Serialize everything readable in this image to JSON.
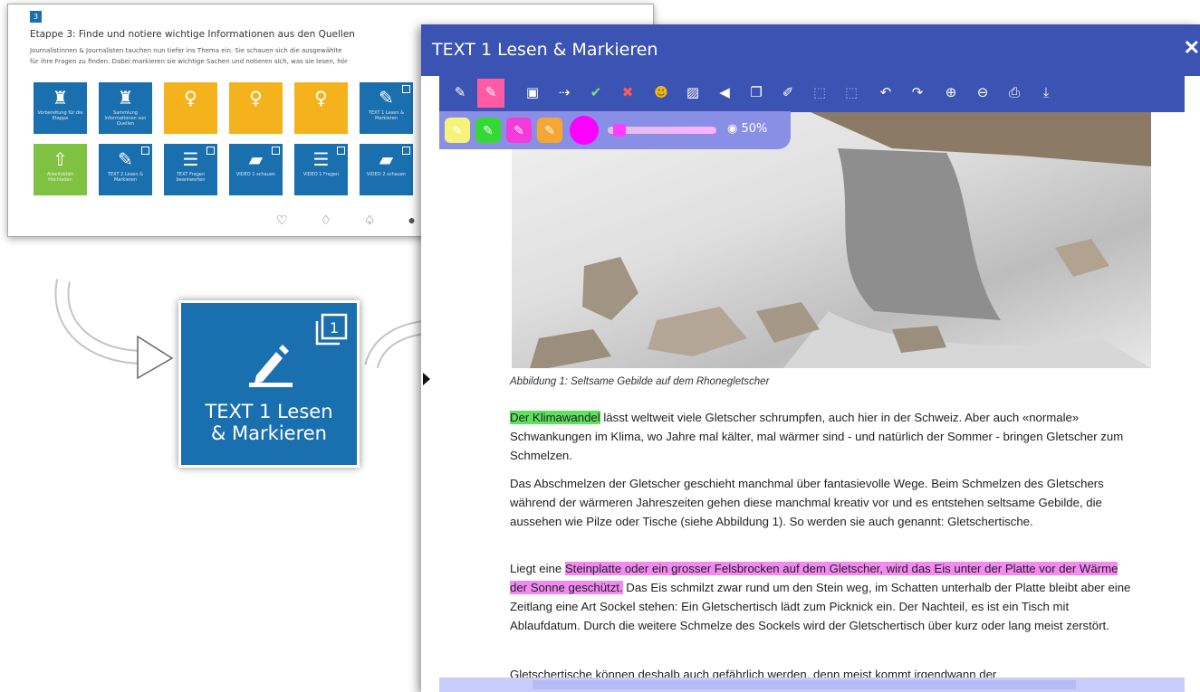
{
  "overview": {
    "step_number": "3",
    "stage_title": "Etappe 3: Finde und notiere wichtige Informationen aus den Quellen",
    "stage_description_line1": "Journalistinnen & Journalisten tauchen nun tiefer ins Thema ein. Sie schauen sich die ausgewählte",
    "stage_description_line2": "für ihre Fragen zu finden. Dabei markieren sie wichtige Sachen und notieren sich, was sie lesen, hör",
    "tiles_row1": [
      {
        "icon": "binoculars-icon",
        "glyph": "♜",
        "color": "blue",
        "label": "Vorbereitung für die Etappe"
      },
      {
        "icon": "binoculars-icon",
        "glyph": "♜",
        "color": "blue",
        "label": "Sammlung Informationen von Quellen"
      },
      {
        "icon": "lightbulb-icon",
        "glyph": "♀",
        "color": "yellow",
        "label": ""
      },
      {
        "icon": "lightbulb-icon",
        "glyph": "♀",
        "color": "yellow",
        "label": ""
      },
      {
        "icon": "lightbulb-icon",
        "glyph": "♀",
        "color": "yellow",
        "label": ""
      },
      {
        "icon": "pencil-icon",
        "glyph": "✎",
        "color": "blue",
        "label": "TEXT 1 Lesen & Markieren"
      }
    ],
    "tiles_row2": [
      {
        "icon": "upload-icon",
        "glyph": "⇧",
        "color": "green",
        "label": "Arbeitsblatt Hochladen"
      },
      {
        "icon": "pencil-icon",
        "glyph": "✎",
        "color": "blue",
        "label": "TEXT 2 Lesen & Markieren"
      },
      {
        "icon": "list-icon",
        "glyph": "☰",
        "color": "blue",
        "label": "TEXT Fragen beantworten"
      },
      {
        "icon": "video-icon",
        "glyph": "▰",
        "color": "blue",
        "label": "VIDEO 1 schauen"
      },
      {
        "icon": "list-icon",
        "glyph": "☰",
        "color": "blue",
        "label": "VIDEO 1 Fragen"
      },
      {
        "icon": "video-icon",
        "glyph": "▰",
        "color": "blue",
        "label": "VIDEO 2 schauen"
      }
    ],
    "feedback_glyphs": "♡ ♢ ♤ ●"
  },
  "zoom_tile": {
    "label_line1": "TEXT 1 Lesen",
    "label_line2": "& Markieren",
    "badge": "1"
  },
  "reader": {
    "title": "TEXT 1 Lesen & Markieren",
    "close_glyph": "✕",
    "opacity_label": "50%",
    "caption": "Abbildung 1: Seltsame Gebilde auf dem Rhonegletscher",
    "p1_hl": "Der Klimawandel",
    "p1_rest": " lässt weltweit viele Gletscher schrumpfen, auch hier in der Schweiz. Aber auch «normale» Schwankungen im Klima, wo Jahre mal kälter, mal wärmer sind - und natürlich der Sommer - bringen Gletscher zum Schmelzen.",
    "p2": "Das Abschmelzen der Gletscher geschieht manchmal über fantasievolle Wege. Beim Schmelzen des Gletschers während der wärmeren Jahreszeiten gehen diese manchmal kreativ vor und es entstehen seltsame Gebilde, die aussehen wie Pilze oder Tische (siehe Abbildung 1). So werden sie auch genannt: Gletschertische.",
    "p3_pre": "Liegt eine ",
    "p3_hl": "Steinplatte oder ein grosser Felsbrocken auf dem Gletscher, wird das Eis unter der Platte vor der Wärme der Sonne geschützt.",
    "p3_rest": " Das Eis schmilzt zwar rund um den Stein weg, im Schatten unterhalb der Platte bleibt aber eine Zeitlang eine Art Sockel stehen: Ein Gletschertisch lädt zum Picknick ein. Der Nachteil, es ist ein Tisch mit Ablaufdatum. Durch die weitere Schmelze des Sockels wird der Gletschertisch über kurz oder lang meist zerstört.",
    "p4_partial": "Gletschertische können deshalb auch gefährlich werden, denn meist kommt irgendwann der"
  }
}
